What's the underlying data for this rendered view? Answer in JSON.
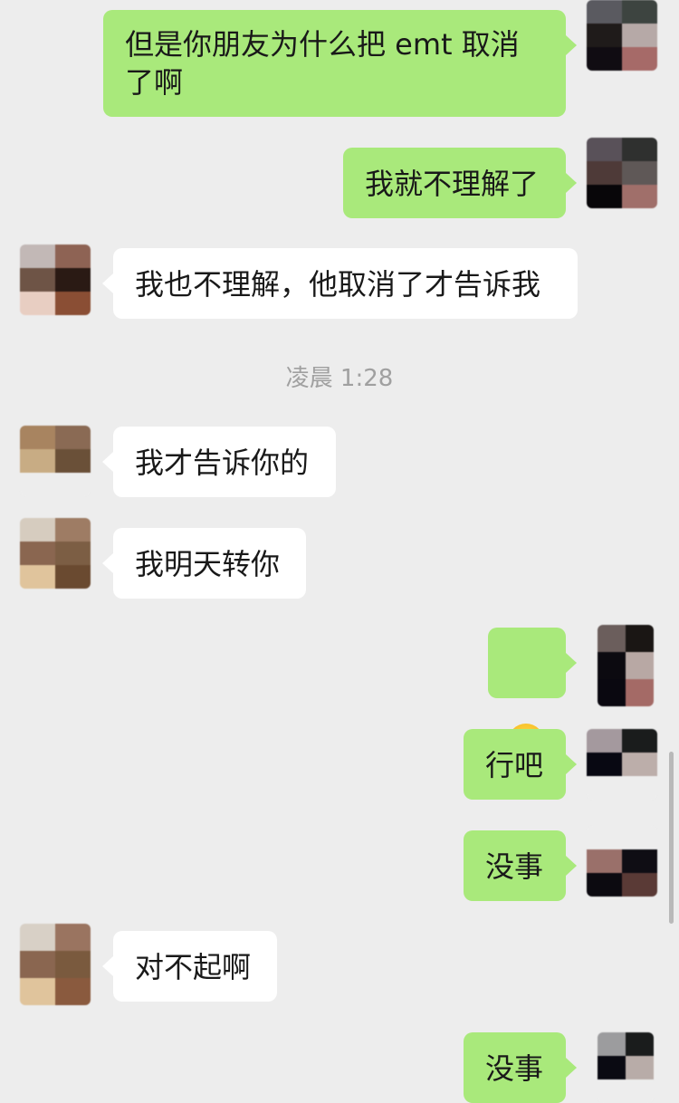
{
  "chat": {
    "messages": [
      {
        "sender": "me",
        "text": "但是你朋友为什么把 emt 取消了啊"
      },
      {
        "sender": "me",
        "text": "我就不理解了"
      },
      {
        "sender": "them",
        "text": "我也不理解，他取消了才告诉我"
      },
      {
        "sender": "them",
        "text": "我才告诉你的"
      },
      {
        "sender": "them",
        "text": "我明天转你"
      },
      {
        "sender": "me",
        "emoji": "face-with-tears-of-joy"
      },
      {
        "sender": "me",
        "text": "行吧"
      },
      {
        "sender": "me",
        "text": "没事"
      },
      {
        "sender": "them",
        "text": "对不起啊"
      },
      {
        "sender": "me",
        "text": "没事"
      }
    ],
    "timestamp": "凌晨 1:28"
  },
  "colors": {
    "background": "#ededed",
    "my_bubble": "#a9e97b",
    "their_bubble": "#ffffff",
    "timestamp_text": "#a0a0a0"
  }
}
